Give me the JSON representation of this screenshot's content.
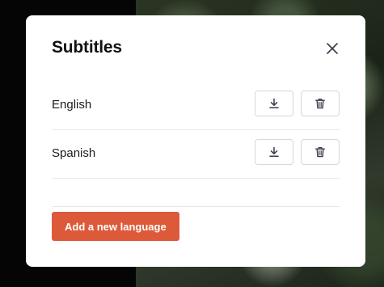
{
  "modal": {
    "title": "Subtitles",
    "close_icon": "close-icon"
  },
  "languages": [
    {
      "name": "English",
      "download_icon": "download-icon",
      "delete_icon": "trash-icon"
    },
    {
      "name": "Spanish",
      "download_icon": "download-icon",
      "delete_icon": "trash-icon"
    }
  ],
  "actions": {
    "add_language_label": "Add a new language"
  },
  "colors": {
    "primary": "#dc5a3a",
    "icon": "#3a3a4a",
    "border": "#d7d7dc",
    "divider": "#e8e8ec"
  }
}
